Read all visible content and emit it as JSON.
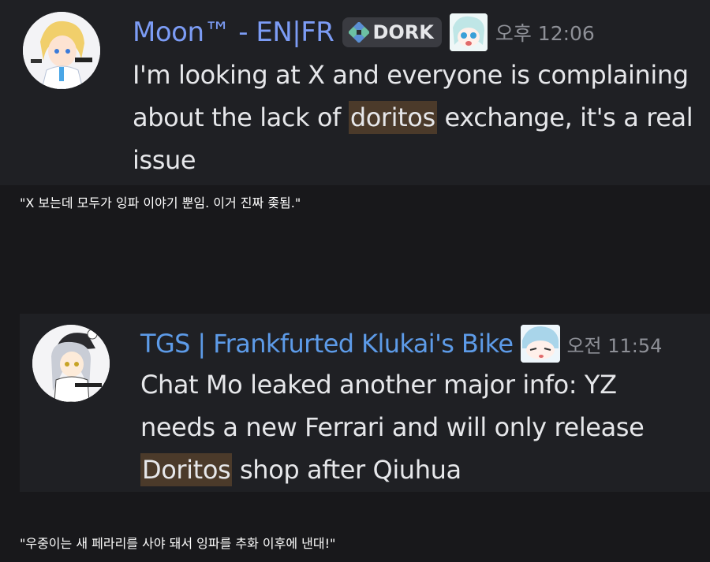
{
  "messages": [
    {
      "username": "Moon™ - EN|FR",
      "role_tag": "DORK",
      "role_icon": "diamond-cross-icon",
      "time": "오후 12:06",
      "text_before": "I'm looking at X and everyone is complaining about the lack of ",
      "highlight": "doritos",
      "text_after": " exchange, it's a real issue",
      "caption": "\"X 보는데 모두가 잉파 이야기 뿐임. 이거 진짜 좆됨.\""
    },
    {
      "username": "TGS | Frankfurted Klukai's Bike",
      "time": "오전 11:54",
      "text_before": "Chat Mo leaked another major info: YZ needs a new Ferrari and will only release ",
      "highlight": "Doritos",
      "text_after": " shop after Qiuhua",
      "caption": "\"우중이는 새 페라리를 사야 돼서 잉파를 추화 이후에 낸대!\""
    }
  ],
  "colors": {
    "background": "#18181b",
    "message_bg": "#1f2024",
    "username_1": "#7c9cf5",
    "username_2": "#5d9be8",
    "highlight": "#4b3a2a",
    "timestamp": "#8e9097"
  }
}
